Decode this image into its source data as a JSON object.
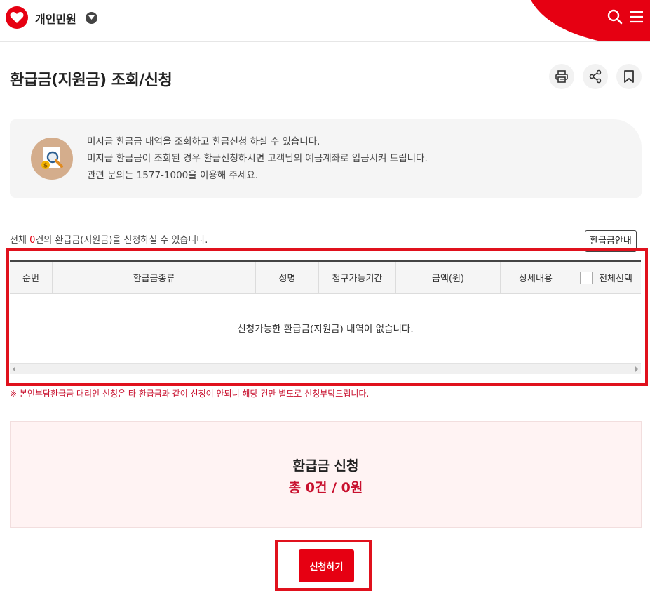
{
  "header": {
    "menu_title": "개인민원",
    "icons": [
      "heart-logo-icon",
      "chevron-down-icon",
      "search-icon",
      "hamburger-menu-icon"
    ],
    "brand_color": "#e60012"
  },
  "page": {
    "title": "환급금(지원금) 조회/신청",
    "tools": [
      "print-icon",
      "share-icon",
      "bookmark-icon"
    ]
  },
  "info": {
    "icon": "document-magnifier-coin-icon",
    "lines": [
      "미지급 환급금 내역을 조회하고 환급신청 하실 수 있습니다.",
      "미지급 환급금이 조회된 경우 환급신청하시면 고객님의 예금계좌로 입금시켜 드립니다.",
      "관련 문의는 1577-1000을 이용해 주세요."
    ]
  },
  "count": {
    "prefix": "전체 ",
    "value": "0",
    "suffix": "건의 환급금(지원금)을 신청하실 수 있습니다."
  },
  "guide_button": "환급금안내",
  "table": {
    "headers": [
      "순번",
      "환급금종류",
      "성명",
      "청구가능기간",
      "금액(원)",
      "상세내용",
      "전체선택"
    ],
    "empty_message": "신청가능한 환급금(지원금) 내역이 없습니다."
  },
  "note": "※ 본인부담환급금 대리인 신청은 타 환급금과 같이 신청이 안되니 해당 건만 별도로 신청부탁드립니다.",
  "summary": {
    "title": "환급금 신청",
    "total": "총 0건 / 0원"
  },
  "submit_button": "신청하기"
}
